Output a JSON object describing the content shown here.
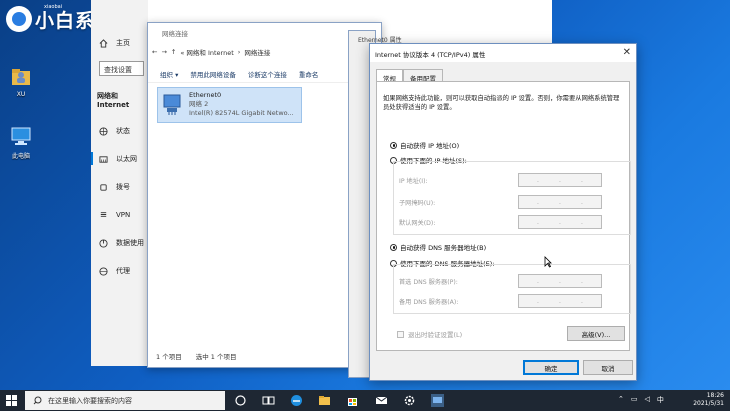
{
  "desktop": {
    "watermark": {
      "brand": "小白系统",
      "small": "xiaobai"
    },
    "icons": [
      {
        "label": "XU"
      },
      {
        "label": "此电脑"
      }
    ]
  },
  "settings": {
    "home": "主页",
    "search_placeholder": "查找设置",
    "section": "网络和 Internet",
    "items": [
      "状态",
      "以太网",
      "拨号",
      "VPN",
      "数据使用",
      "代理"
    ]
  },
  "netwin": {
    "title": "网络连接",
    "breadcrumb": [
      "« 网络和 Internet",
      "网络连接"
    ],
    "toolbar": [
      "组织 ▾",
      "禁用此网络设备",
      "诊断这个连接",
      "重命名"
    ],
    "adapter": {
      "name": "Ethernet0",
      "network": "网络 2",
      "device": "Intel(R) 82574L Gigabit Netwo..."
    },
    "status": {
      "count": "1 个项目",
      "selected": "选中 1 个项目"
    }
  },
  "ethprops": {
    "title": "Ethernet0 属性"
  },
  "dialog": {
    "title": "Internet 协议版本 4 (TCP/IPv4) 属性",
    "tabs": [
      "常规",
      "备用配置"
    ],
    "description": "如果网络支持此功能，则可以获取自动指派的 IP 设置。否则，你需要从网络系统管理员处获得适当的 IP 设置。",
    "ip_auto": "自动获得 IP 地址(O)",
    "ip_manual": "使用下面的 IP 地址(S):",
    "ip_fields": [
      "IP 地址(I):",
      "子网掩码(U):",
      "默认网关(D):"
    ],
    "dns_auto": "自动获得 DNS 服务器地址(B)",
    "dns_manual": "使用下面的 DNS 服务器地址(E):",
    "dns_fields": [
      "首选 DNS 服务器(P):",
      "备用 DNS 服务器(A):"
    ],
    "ip_placeholder_dots": [
      ".",
      ".",
      "."
    ],
    "validate": "退出时验证设置(L)",
    "advanced": "高级(V)...",
    "ok": "确定",
    "cancel": "取消"
  },
  "taskbar": {
    "search_placeholder": "在这里输入你要搜索的内容",
    "ime": "中",
    "time": "18:26",
    "date": "2021/5/31"
  },
  "colors": {
    "accent": "#0078d7",
    "selection": "#cfe3f8",
    "taskbar": "#1e2733"
  }
}
